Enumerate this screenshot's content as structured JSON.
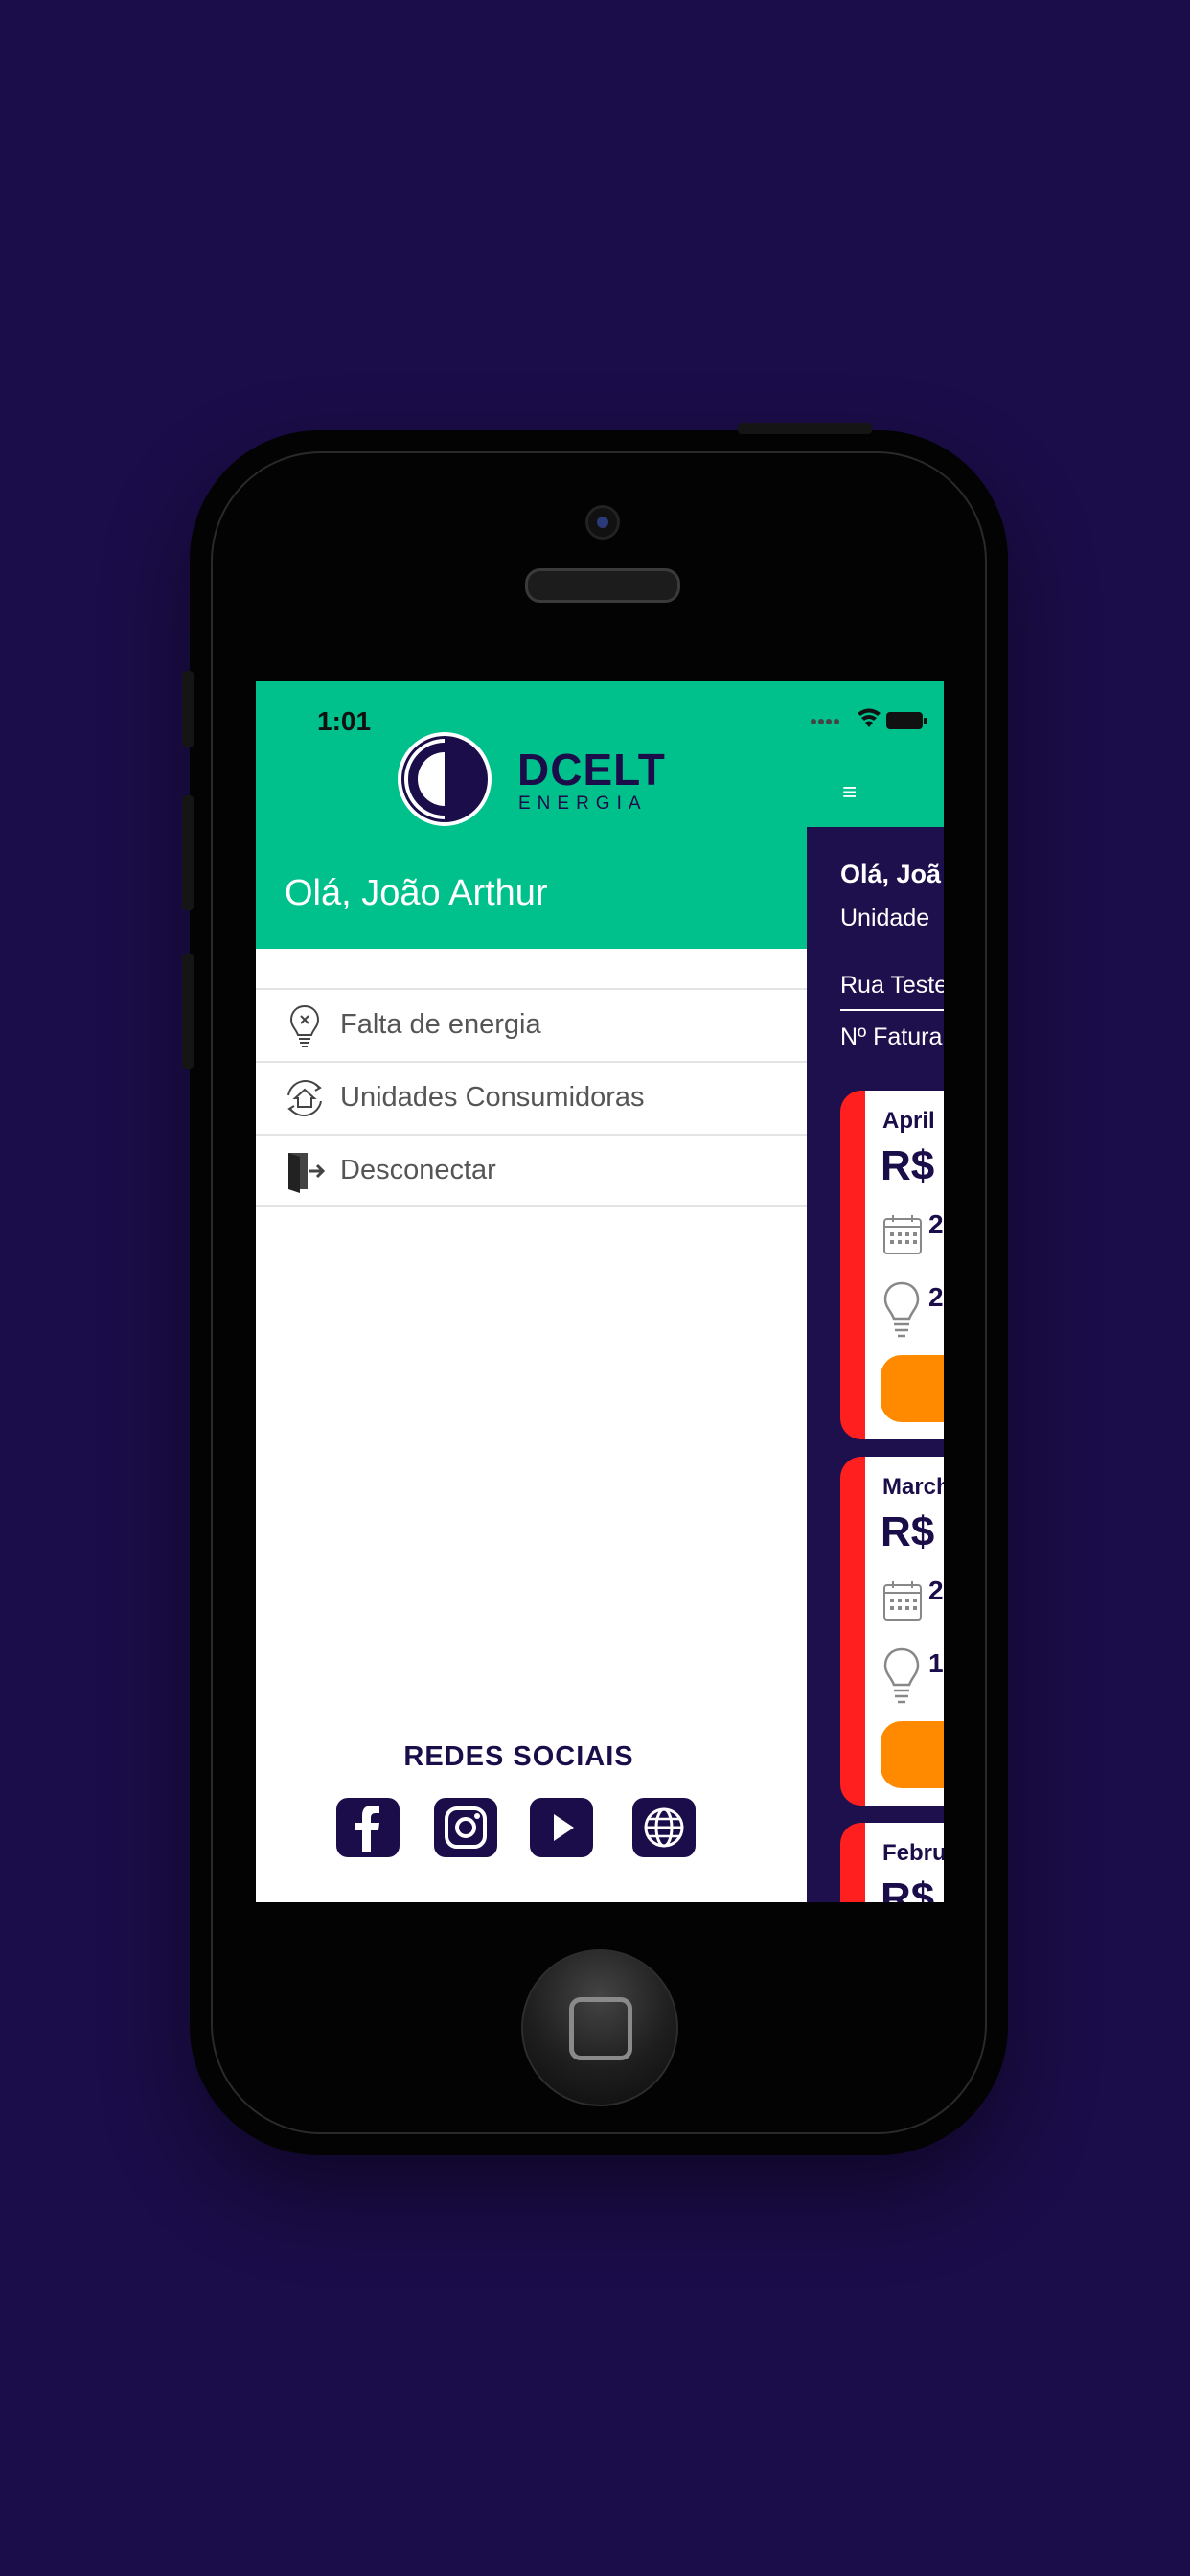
{
  "colors": {
    "background": "#1b0d49",
    "brand_green": "#00c08b",
    "navy": "#1b0d49",
    "accent_red": "#ff1f1f",
    "accent_orange": "#ff8a00"
  },
  "status_bar": {
    "time": "1:01",
    "icons": [
      "signal-icon",
      "wifi-icon",
      "battery-icon"
    ]
  },
  "logo": {
    "brand": "DCELT",
    "subtitle": "ENERGIA"
  },
  "drawer": {
    "greeting": "Olá, João Arthur",
    "menu": [
      {
        "label": "Falta de energia",
        "icon": "bulb-off-icon"
      },
      {
        "label": "Unidades Consumidoras",
        "icon": "house-sync-icon"
      },
      {
        "label": "Desconectar",
        "icon": "logout-door-icon"
      }
    ],
    "social_title": "REDES SOCIAIS",
    "social_icons": [
      "facebook-icon",
      "instagram-icon",
      "youtube-icon",
      "globe-icon"
    ]
  },
  "main": {
    "menu_icon": "≡",
    "greeting": "Olá, Joã",
    "unit_label": "Unidade",
    "address": "Rua Teste",
    "invoice_label": "Nº Fatura",
    "cards": [
      {
        "month": "April",
        "amount": "R$",
        "date_digit": "2",
        "consumption_digit": "2"
      },
      {
        "month": "March",
        "amount": "R$",
        "date_digit": "2",
        "consumption_digit": "1"
      },
      {
        "month": "Febru",
        "amount": "R$"
      }
    ]
  }
}
